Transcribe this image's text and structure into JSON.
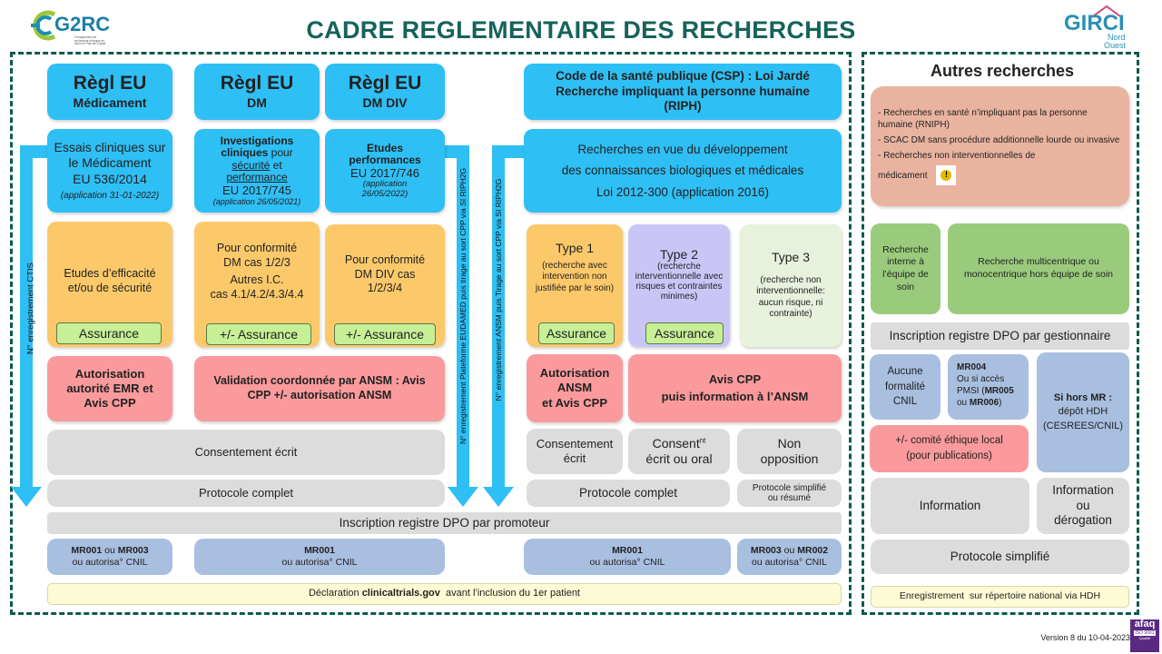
{
  "header": {
    "title": "CADRE REGLEMENTAIRE DES RECHERCHES",
    "logo_left": {
      "name": "G2RC",
      "subtitle": "Groupement de recherche clinique en Nord et Pas-de-Calais"
    },
    "logo_right": {
      "name": "GIRCI",
      "subtitle_1": "Nord",
      "subtitle_2": "Ouest"
    }
  },
  "colors": {
    "frame": "#0c5a4e",
    "title": "#16635a",
    "blue": "#2ebff5",
    "orange": "#fcc96a",
    "pink": "#fa9a9c",
    "grey": "#dcdcdc",
    "steel": "#a8bfdf",
    "green": "#9acb7c"
  },
  "main": {
    "columns": [
      {
        "title": "Règl EU",
        "subtitle": "Médicament"
      },
      {
        "title": "Règl EU",
        "subtitle": "DM"
      },
      {
        "title": "Règl EU",
        "subtitle": "DM DIV"
      }
    ],
    "csp": {
      "line1": "Code de la santé publique (CSP) : Loi Jardé",
      "line2": "Recherche impliquant la personne humaine",
      "line3": "(RIPH)"
    },
    "reg_med": {
      "l1": "Essais cliniques sur",
      "l2": "le Médicament",
      "l3": "EU 536/2014",
      "l4": "(application 31-01-2022)"
    },
    "reg_dm": {
      "l1a": "Investigations",
      "l1b": "cliniques",
      "l1c": " pour",
      "l2a": "sécurité",
      "l2b": " et",
      "l3": "performance",
      "l4": "EU 2017/745",
      "l5": "(application 26/05/2021)"
    },
    "reg_div": {
      "l1": "Etudes",
      "l2": "performances",
      "l3": "EU 2017/746",
      "l4": "(application",
      "l5": "26/05/2022)"
    },
    "riph_desc": {
      "l1": "Recherches en vue du développement",
      "l2": "des connaissances biologiques et médicales",
      "l3": "Loi 2012-300 (application 2016)"
    },
    "purpose_med": {
      "l1": "Etudes d’efficacité",
      "l2": "et/ou de sécurité",
      "insurance": "Assurance"
    },
    "purpose_dm": {
      "l1": "Pour conformité",
      "l2": "DM cas 1/2/3",
      "l3": "Autres I.C.",
      "l4": "cas 4.1/4.2/4.3/4.4",
      "insurance": "+/- Assurance"
    },
    "purpose_div": {
      "l1": "Pour conformité",
      "l2": "DM DIV cas",
      "l3": "1/2/3/4",
      "insurance": "+/- Assurance"
    },
    "types": [
      {
        "title": "Type 1",
        "desc": "(recherche avec intervention non justifiée par le soin)",
        "insurance": "Assurance"
      },
      {
        "title": "Type 2",
        "desc": "(recherche interventionnelle avec risques et contraintes minimes)",
        "insurance": "Assurance"
      },
      {
        "title": "Type 3",
        "desc": "(recherche non interventionnelle: aucun risque, ni contrainte)"
      }
    ],
    "auth_med": {
      "l1": "Autorisation",
      "l2": "autorité EMR et",
      "l3": "Avis CPP"
    },
    "auth_dm": {
      "l1": "Validation coordonnée par ANSM : Avis",
      "l2": "CPP +/- autorisation ANSM"
    },
    "auth_t1": {
      "l1": "Autorisation",
      "l2": "ANSM",
      "l3": "et Avis CPP"
    },
    "auth_t23": {
      "l1": "Avis CPP",
      "l2": "puis information à l’ANSM"
    },
    "consent_eu": "Consentement écrit",
    "consent_t1": {
      "l1": "Consentement",
      "l2": "écrit"
    },
    "consent_t2": {
      "l1": "Consent",
      "sup": "nt",
      "l2": "écrit ou oral"
    },
    "consent_t3": {
      "l1": "Non",
      "l2": "opposition"
    },
    "protocol_eu": "Protocole complet",
    "protocol_t12": "Protocole complet",
    "protocol_t3": {
      "l1": "Protocole simplifié",
      "l2": "ou résumé"
    },
    "dpo": "Inscription registre DPO par promoteur",
    "mr": [
      {
        "b1": "MR001",
        "mid": " ou ",
        "b2": "MR003",
        "l2": "ou autorisa° CNIL"
      },
      {
        "b1": "MR001",
        "l2": "ou autorisa° CNIL"
      },
      {
        "b1": "MR001",
        "l2": "ou autorisa° CNIL"
      },
      {
        "b1": "MR003",
        "mid": " ou ",
        "b2": "MR002",
        "l2": "ou autorisa° CNIL"
      }
    ],
    "declaration": {
      "pre": "Déclaration ",
      "bold": "clinicaltrials.gov",
      "post": "  avant l’inclusion du 1er patient"
    },
    "arrows": [
      {
        "label": "N° enregistrement CTIS"
      },
      {
        "label": "N° enregistrement Plateforme EUDAMED puis tirage au sort CPP via SI RIPH2G"
      },
      {
        "label": "N° enregistrement ANSM puis Tirage au sort CPP via SI RIPH2G"
      }
    ]
  },
  "side": {
    "title": "Autres recherches",
    "list": [
      "- Recherches en santé n’impliquant pas la personne humaine (RNIPH)",
      "- SCAC DM sans procédure additionnelle lourde ou invasive",
      "- Recherches non interventionnelles de"
    ],
    "list_last": "médicament",
    "internal": {
      "l1": "Recherche",
      "l2": "interne à",
      "l3": "l’équipe de",
      "l4": "soin"
    },
    "multicentric": {
      "l1": "Recherche multicentrique ou",
      "l2": "monocentrique hors équipe de soin"
    },
    "dpo": "Inscription registre DPO par gestionnaire",
    "no_cnil": {
      "l1": "Aucune",
      "l2": "formalité",
      "l3": "CNIL"
    },
    "mr004": {
      "b1": "MR004",
      "l2": "Ou si accès",
      "l3a": "PMSI (",
      "b2": "MR005",
      "l4a": "ou ",
      "b3": "MR006",
      "l4b": ")"
    },
    "hdh": {
      "b": "Si hors MR :",
      "l2": "dépôt HDH",
      "l3": "(CESREES/CNIL)"
    },
    "ethics": {
      "l1": "+/- comité éthique local",
      "l2": "(pour publications)"
    },
    "information": "Information",
    "info_derog": {
      "l1": "Information",
      "l2": "ou",
      "l3": "dérogation"
    },
    "protocol": "Protocole simplifié",
    "registration": "Enregistrement  sur répertoire national via HDH"
  },
  "footer": {
    "version": "Version 8 du 10-04-2023",
    "badge": {
      "l1": "afaq",
      "l2": "ISO 9001",
      "l3": "Qualité"
    }
  }
}
